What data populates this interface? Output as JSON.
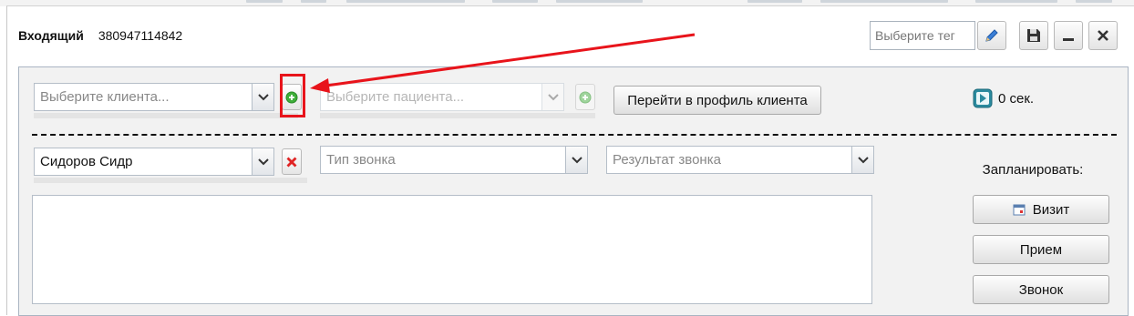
{
  "header": {
    "call_type": "Входящий",
    "phone_number": "380947114842",
    "tag_placeholder": "Выберите тег"
  },
  "icons": {
    "edit": "pencil-icon",
    "save": "floppy-disk-icon",
    "minimize": "minimize-icon",
    "close": "close-icon",
    "add": "green-plus-circle-icon",
    "remove": "red-x-icon",
    "play": "play-icon",
    "calendar": "calendar-icon"
  },
  "client_row": {
    "client_placeholder": "Выберите клиента...",
    "patient_placeholder": "Выберите пациента...",
    "go_to_profile_label": "Перейти в профиль клиента",
    "timer": "0 сек."
  },
  "call_row": {
    "contact_value": "Сидоров Сидр",
    "call_type_placeholder": "Тип звонка",
    "call_result_placeholder": "Результат звонка"
  },
  "schedule": {
    "label": "Запланировать:",
    "visit_label": "Визит",
    "appointment_label": "Прием",
    "call_label": "Звонок"
  },
  "colors": {
    "annotation": "#e8141b",
    "panel_border": "#a9b4c2",
    "add_icon": "#3fae3a",
    "remove_icon": "#e02424",
    "play_icon": "#2a8a9e"
  }
}
